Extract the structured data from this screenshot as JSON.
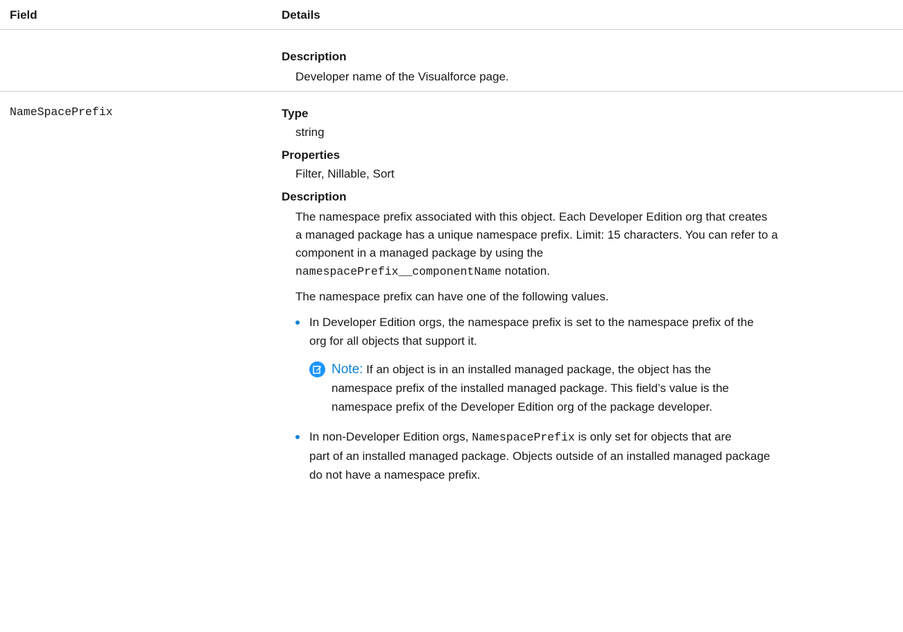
{
  "header": {
    "field": "Field",
    "details": "Details"
  },
  "row1": {
    "description_label": "Description",
    "description_text": "Developer name of the Visualforce page."
  },
  "row2": {
    "field_name": "NameSpacePrefix",
    "type_label": "Type",
    "type_value": "string",
    "properties_label": "Properties",
    "properties_value": "Filter, Nillable, Sort",
    "description_label": "Description",
    "para1_line1": "The namespace prefix associated with this object. Each Developer Edition org that creates",
    "para1_line2": "a managed package has a unique namespace prefix. Limit: 15 characters. You can refer to a",
    "para1_line3": "component in a managed package by using the",
    "para1_code": "namespacePrefix__componentName",
    "para1_after": " notation.",
    "para2": "The namespace prefix can have one of the following values.",
    "bullet1_line1": "In Developer Edition orgs, the namespace prefix is set to the namespace prefix of the",
    "bullet1_line2": "org for all objects that support it.",
    "note_label": "Note:",
    "note_line1": " If an object is in an installed managed package, the object has the",
    "note_line2": "namespace prefix of the installed managed package. This field’s value is the",
    "note_line3": "namespace prefix of the Developer Edition org of the package developer.",
    "bullet2_before": "In non-Developer Edition orgs, ",
    "bullet2_code": "NamespacePrefix",
    "bullet2_after": " is only set for objects that are",
    "bullet2_line2": "part of an installed managed package. Objects outside of an installed managed package",
    "bullet2_line3": "do not have a namespace prefix."
  },
  "colors": {
    "accent": "#0b82d4",
    "note_icon": "#1b96ff",
    "divider": "#cfcfcf"
  },
  "icons": {
    "note": "edit-note-icon",
    "bullet": "bullet-dot-icon"
  }
}
